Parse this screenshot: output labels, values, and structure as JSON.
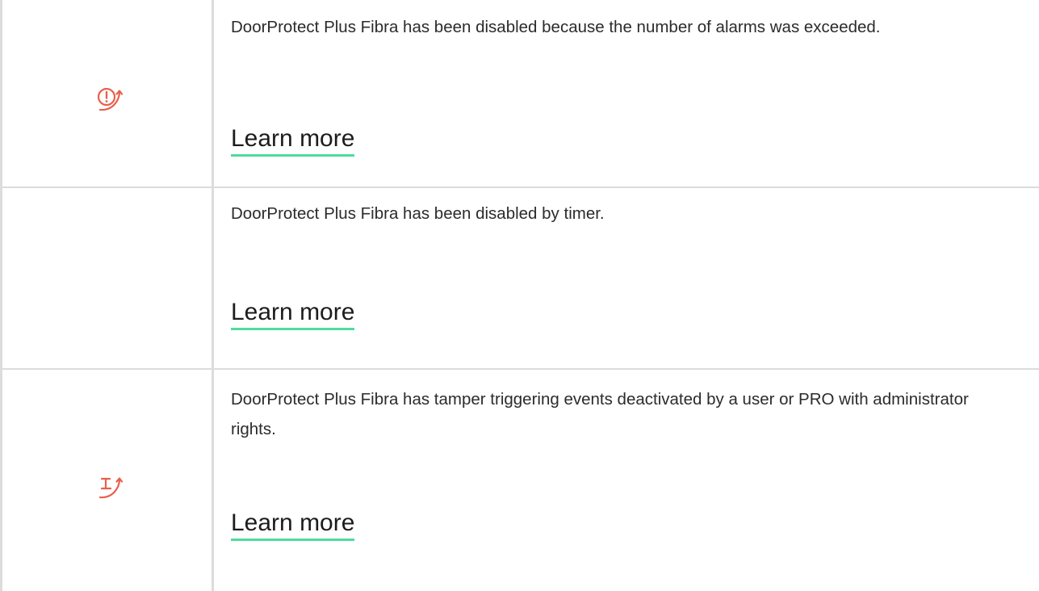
{
  "colors": {
    "icon_accent": "#e8604c",
    "link_underline": "#4fdc9e",
    "border": "#dcdcdc"
  },
  "rows": [
    {
      "icon": "alarm-limit-disabled-icon",
      "description": "DoorProtect Plus Fibra has been disabled because the number of alarms was exceeded.",
      "link": "Learn more"
    },
    {
      "icon": "",
      "description": "DoorProtect Plus Fibra has been disabled by timer.",
      "link": "Learn more"
    },
    {
      "icon": "tamper-deactivated-icon",
      "description": "DoorProtect Plus Fibra has tamper triggering events deactivated by a user or PRO with administrator rights.",
      "link": "Learn more"
    }
  ]
}
